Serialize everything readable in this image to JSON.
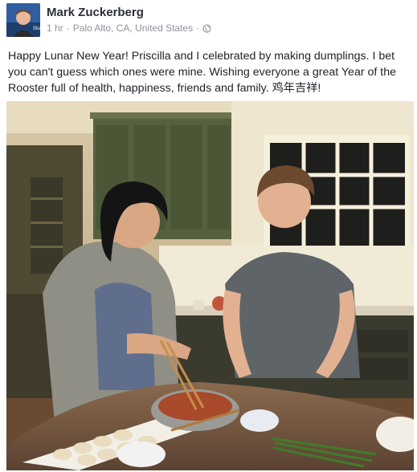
{
  "post": {
    "author": "Mark Zuckerberg",
    "time": "1 hr",
    "separator": "·",
    "location": "Palo Alto, CA, United States",
    "separator2": "·",
    "privacy_icon": "globe-icon",
    "text": "Happy Lunar New Year! Priscilla and I celebrated by making dumplings. I bet you can't guess which ones were mine. Wishing everyone a great Year of the Rooster full of health, happiness, friends and family. 鸡年吉祥!",
    "avatar_icon": "profile-photo",
    "photo": "kitchen-photo"
  },
  "colors": {
    "author": "#2b2f36",
    "meta": "#90949c",
    "text": "#1d2129",
    "brand": "#3b5998"
  }
}
